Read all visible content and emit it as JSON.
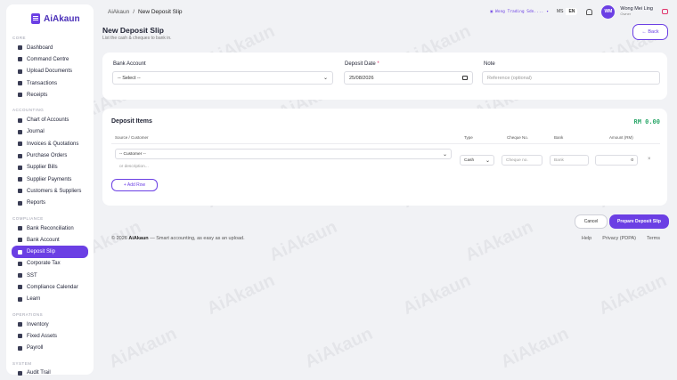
{
  "brand": {
    "name": "AiAkaun"
  },
  "watermark": "AiAkaun",
  "sidebar": {
    "sections": [
      {
        "title": "CORE",
        "items": [
          {
            "label": "Dashboard",
            "icon": "dashboard-icon"
          },
          {
            "label": "Command Centre",
            "icon": "grid-icon"
          },
          {
            "label": "Upload Documents",
            "icon": "upload-icon"
          },
          {
            "label": "Transactions",
            "icon": "list-icon"
          },
          {
            "label": "Receipts",
            "icon": "receipt-icon"
          }
        ]
      },
      {
        "title": "ACCOUNTING",
        "items": [
          {
            "label": "Chart of Accounts",
            "icon": "chart-icon"
          },
          {
            "label": "Journal",
            "icon": "journal-icon"
          },
          {
            "label": "Invoices & Quotations",
            "icon": "invoice-icon"
          },
          {
            "label": "Purchase Orders",
            "icon": "cart-icon"
          },
          {
            "label": "Supplier Bills",
            "icon": "bill-icon"
          },
          {
            "label": "Supplier Payments",
            "icon": "payment-icon"
          },
          {
            "label": "Customers & Suppliers",
            "icon": "users-icon"
          },
          {
            "label": "Reports",
            "icon": "report-icon"
          }
        ]
      },
      {
        "title": "COMPLIANCE",
        "items": [
          {
            "label": "Bank Reconciliation",
            "icon": "check-icon"
          },
          {
            "label": "Bank Account",
            "icon": "bank-icon"
          },
          {
            "label": "Deposit Slip",
            "icon": "deposit-icon",
            "active": true
          },
          {
            "label": "Corporate Tax",
            "icon": "tax-icon"
          },
          {
            "label": "SST",
            "icon": "sst-icon"
          },
          {
            "label": "Compliance Calendar",
            "icon": "calendar-icon"
          },
          {
            "label": "Learn",
            "icon": "learn-icon"
          }
        ]
      },
      {
        "title": "OPERATIONS",
        "items": [
          {
            "label": "Inventory",
            "icon": "inventory-icon"
          },
          {
            "label": "Fixed Assets",
            "icon": "assets-icon"
          },
          {
            "label": "Payroll",
            "icon": "payroll-icon"
          }
        ]
      },
      {
        "title": "SYSTEM",
        "items": [
          {
            "label": "Audit Trail",
            "icon": "audit-icon"
          }
        ]
      }
    ]
  },
  "topbar": {
    "breadcrumb_root": "AiAkaun",
    "breadcrumb_sep": "/",
    "breadcrumb_current": "New Deposit Slip",
    "company": "Wong Trading Sdn....",
    "lang_ms": "MS",
    "lang_en": "EN",
    "avatar_initials": "WM",
    "user_name": "Wong Mei Ling",
    "user_role": "Owner"
  },
  "page": {
    "title": "New Deposit Slip",
    "subtitle": "List the cash & cheques to bank in.",
    "back_label": "← Back"
  },
  "form": {
    "bank_account_label": "Bank Account",
    "bank_account_value": "-- Select --",
    "deposit_date_label": "Deposit Date",
    "deposit_date_required": "*",
    "deposit_date_value": "25/08/2026",
    "note_label": "Note",
    "note_placeholder": "Reference (optional)"
  },
  "items": {
    "title": "Deposit Items",
    "total": "RM 0.00",
    "headers": {
      "source": "Source / Customer",
      "type": "Type",
      "cheque": "Cheque No.",
      "bank": "Bank",
      "amount": "Amount (RM)"
    },
    "row": {
      "customer": "-- Customer --",
      "description_placeholder": "or description...",
      "type": "Cash",
      "cheque_placeholder": "Cheque no.",
      "bank_placeholder": "Bank",
      "amount": "0",
      "remove": "×"
    },
    "add_row": "+ Add Row"
  },
  "actions": {
    "cancel": "Cancel",
    "prepare": "Prepare Deposit Slip"
  },
  "footer": {
    "copyright_prefix": "© 2026 ",
    "brand": "AiAkaun",
    "tagline": " — Smart accounting, as easy as an upload.",
    "links": [
      "Help",
      "Privacy (PDPA)",
      "Terms"
    ]
  }
}
